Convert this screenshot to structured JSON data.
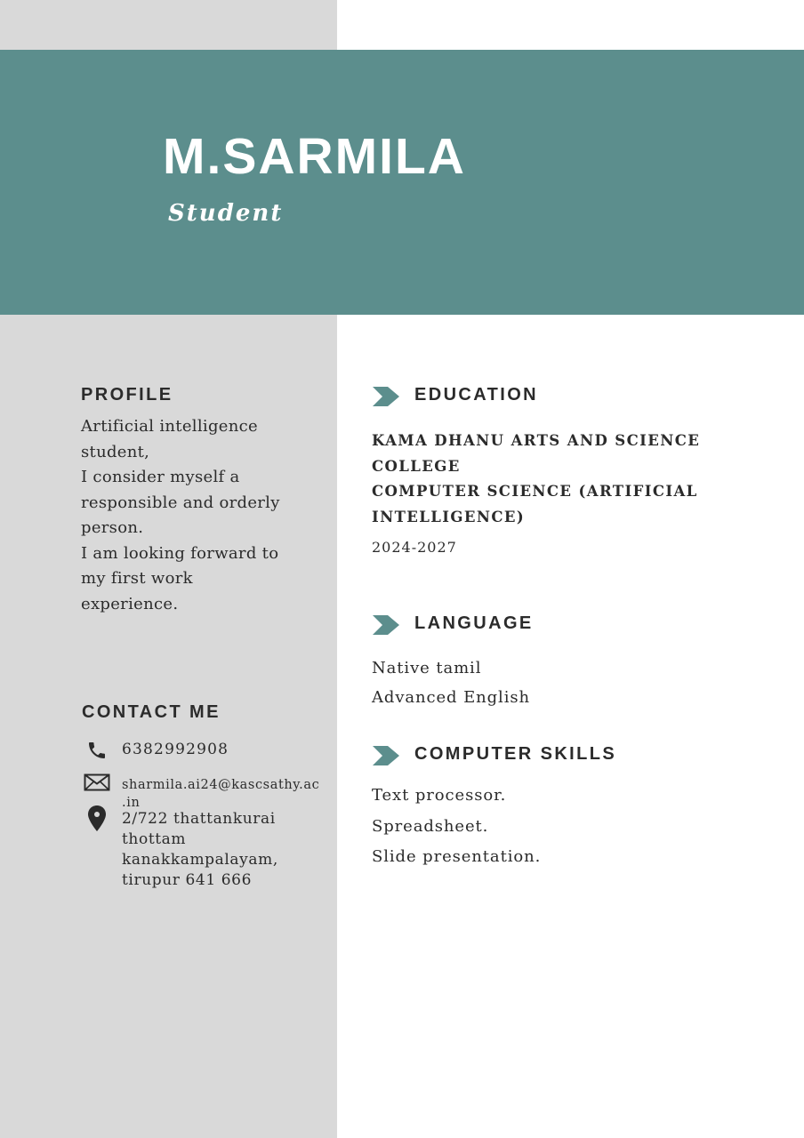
{
  "header": {
    "name": "M.SARMILA",
    "role": "Student"
  },
  "profile": {
    "heading": "PROFILE",
    "text": "Artificial intelligence\nstudent,\nI consider myself a\nresponsible and orderly\nperson.\nI am looking forward to\nmy first work\nexperience."
  },
  "contact": {
    "heading": "CONTACT ME",
    "phone": "6382992908",
    "email": "sharmila.ai24@kascsathy.ac\n.in",
    "address": "2/722 thattankurai\nthottam\nkanakkampalayam,\ntirupur 641 666",
    "icons": [
      "phone-icon",
      "envelope-icon",
      "map-pin-icon"
    ]
  },
  "education": {
    "heading": "EDUCATION",
    "school_line1": "KAMA DHANU ARTS AND SCIENCE COLLEGE",
    "school_line2": "COMPUTER SCIENCE (ARTIFICIAL INTELLIGENCE)",
    "years": "2024-2027"
  },
  "language": {
    "heading": "LANGUAGE",
    "items": [
      "Native tamil",
      "Advanced English"
    ]
  },
  "computer_skills": {
    "heading": "COMPUTER SKILLS",
    "items": [
      "Text processor.",
      "Spreadsheet.",
      "Slide presentation."
    ]
  },
  "colors": {
    "accent": "#5c8e8d",
    "sidebar": "#d9d9d9",
    "text": "#2b2b2b",
    "background": "#ffffff"
  }
}
